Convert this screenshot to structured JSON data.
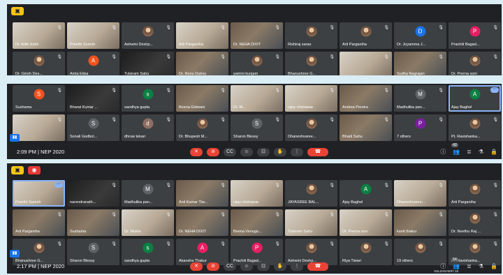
{
  "colors": {
    "background": "#dbeef6",
    "panel": "#202124",
    "tile": "#3c4043",
    "danger": "#ea4335",
    "accent": "#8ab4f8"
  },
  "icons": {
    "present_icon": "▣",
    "record_icon": "◉",
    "mic_muted_icon": "🎙",
    "more_icon": "⋯",
    "mic_off": "✕",
    "cam_off": "⊘",
    "cc": "CC",
    "emoji": "☺",
    "present": "⊡",
    "hand": "✋",
    "more": "⋮",
    "end_call": "☎",
    "info": "ⓘ",
    "people": "👥",
    "chat": "≣",
    "activities": "⚗",
    "lock": "🔒"
  },
  "panel1": {
    "tiles": [
      {
        "name": "Dr. Aditi Joshi",
        "type": "video",
        "style": "light"
      },
      {
        "name": "Preethi Suresh",
        "type": "video",
        "style": "light",
        "speaking": true
      },
      {
        "name": "Ashwini Deshp...",
        "type": "photo"
      },
      {
        "name": "Arti Parganiha",
        "type": "video",
        "style": "light"
      },
      {
        "name": "Dr. NEHA DIXIT",
        "type": "video"
      },
      {
        "name": "Rishiraj saras",
        "type": "photo"
      },
      {
        "name": "Arti Parganiha",
        "type": "photo"
      },
      {
        "name": "Dr. Joyamma J...",
        "type": "letter",
        "letter": "D",
        "color": "#1a73e8"
      },
      {
        "name": "Prachiti Bagad...",
        "type": "letter",
        "letter": "P",
        "color": "#e91e63"
      },
      {
        "name": "Dr. Girish Des...",
        "type": "photo"
      },
      {
        "name": "Amla Ekka",
        "type": "letter",
        "letter": "A",
        "color": "#f4511e"
      },
      {
        "name": "Tulsiram Sahu",
        "type": "video",
        "style": "dark"
      },
      {
        "name": "Dr. Renu Dubey",
        "type": "video"
      },
      {
        "name": "yamini kunjam",
        "type": "photo"
      },
      {
        "name": "Bhanushree G...",
        "type": "photo"
      },
      {
        "name": "",
        "type": "video",
        "style": "light"
      },
      {
        "name": "Sudha Nagrajan",
        "type": "video"
      },
      {
        "name": "Dr. Prerna soni",
        "type": "photo"
      }
    ]
  },
  "panel2": {
    "tiles": [
      {
        "name": "Sushama",
        "type": "letter",
        "letter": "S",
        "color": "#f4511e"
      },
      {
        "name": "Bharat Kumar ...",
        "type": "video",
        "style": "dark"
      },
      {
        "name": "sandhya gupta",
        "type": "letter",
        "letter": "s",
        "color": "#0b8043"
      },
      {
        "name": "Beena Gidwani",
        "type": "video"
      },
      {
        "name": "Dr. M...",
        "type": "video",
        "style": "light"
      },
      {
        "name": "vijay chidrawar",
        "type": "video",
        "style": "light"
      },
      {
        "name": "Andrea Pereira",
        "type": "video"
      },
      {
        "name": "Madhulika pan...",
        "type": "letter",
        "letter": "M",
        "color": "#5f6368"
      },
      {
        "name": "Ajay Baghel",
        "type": "letter",
        "letter": "A",
        "color": "#0b8043",
        "selected": true
      },
      {
        "name": "",
        "type": "video",
        "style": "light"
      },
      {
        "name": "Sonali Godbol...",
        "type": "letter",
        "letter": "S",
        "color": "#5f6368"
      },
      {
        "name": "dhruw tekari",
        "type": "letter",
        "letter": "d",
        "color": "#8d6e63"
      },
      {
        "name": "Dr. Bhupesh M...",
        "type": "photo"
      },
      {
        "name": "Sharon Blessy",
        "type": "letter",
        "letter": "S",
        "color": "#5f6368"
      },
      {
        "name": "Dhaneshvaree...",
        "type": "photo"
      },
      {
        "name": "Bharti Sahu",
        "type": "video"
      },
      {
        "name": "7 others",
        "type": "letter",
        "letter": "P",
        "color": "#7b1fa2"
      },
      {
        "name": "Pt. Ravishanka...",
        "type": "photo"
      }
    ],
    "time": "2:09 PM",
    "separator": "|",
    "meeting": "NEP 2020",
    "people_count": "42"
  },
  "panel3": {
    "tiles": [
      {
        "name": "Preethi Suresh",
        "type": "video",
        "style": "light",
        "selected": true
      },
      {
        "name": "narendranath...",
        "type": "video",
        "style": "dark"
      },
      {
        "name": "Madhulika pan...",
        "type": "letter",
        "letter": "M",
        "color": "#5f6368"
      },
      {
        "name": "Anil Kumar Tiw...",
        "type": "video"
      },
      {
        "name": "vijay chidrawar",
        "type": "video",
        "style": "light"
      },
      {
        "name": "JAYASREE BAL...",
        "type": "photo"
      },
      {
        "name": "Ajay Baghel",
        "type": "letter",
        "letter": "A",
        "color": "#0b8043"
      },
      {
        "name": "Dhaneshvaree...",
        "type": "video",
        "style": "light"
      },
      {
        "name": "Arti Parganiha",
        "type": "photo"
      },
      {
        "name": "Arti Parganiha",
        "type": "video"
      },
      {
        "name": "Sushama",
        "type": "video"
      },
      {
        "name": "Dr. Mukta",
        "type": "video",
        "style": "light"
      },
      {
        "name": "Dr. NEHA DIXIT",
        "type": "video"
      },
      {
        "name": "Beena Venugo...",
        "type": "video"
      },
      {
        "name": "Tulsiram Sahu",
        "type": "video",
        "style": "light"
      },
      {
        "name": "Dr. Prerna soni",
        "type": "video",
        "style": "light"
      },
      {
        "name": "kanti thakur",
        "type": "video"
      },
      {
        "name": "Dr. Neethu Raj ...",
        "type": "photo"
      },
      {
        "name": "Bhanushree G...",
        "type": "photo"
      },
      {
        "name": "Sharon Blessy",
        "type": "letter",
        "letter": "S",
        "color": "#5f6368"
      },
      {
        "name": "sandhya gupta",
        "type": "letter",
        "letter": "s",
        "color": "#0b8043"
      },
      {
        "name": "Akansha Thakur",
        "type": "letter",
        "letter": "A",
        "color": "#e91e63"
      },
      {
        "name": "Prachiti Bagad...",
        "type": "letter",
        "letter": "P",
        "color": "#e91e63"
      },
      {
        "name": "Ashwini Deshp...",
        "type": "photo"
      },
      {
        "name": "Riya Tiwari",
        "type": "photo"
      },
      {
        "name": "19 others",
        "type": "photo"
      },
      {
        "name": "Pt. Ravishanka...",
        "type": "photo"
      }
    ],
    "time": "2:17 PM",
    "separator": "|",
    "meeting": "NEP 2020",
    "people_count": "54",
    "wifi_text": "SSLZAN-WIFI 18"
  }
}
